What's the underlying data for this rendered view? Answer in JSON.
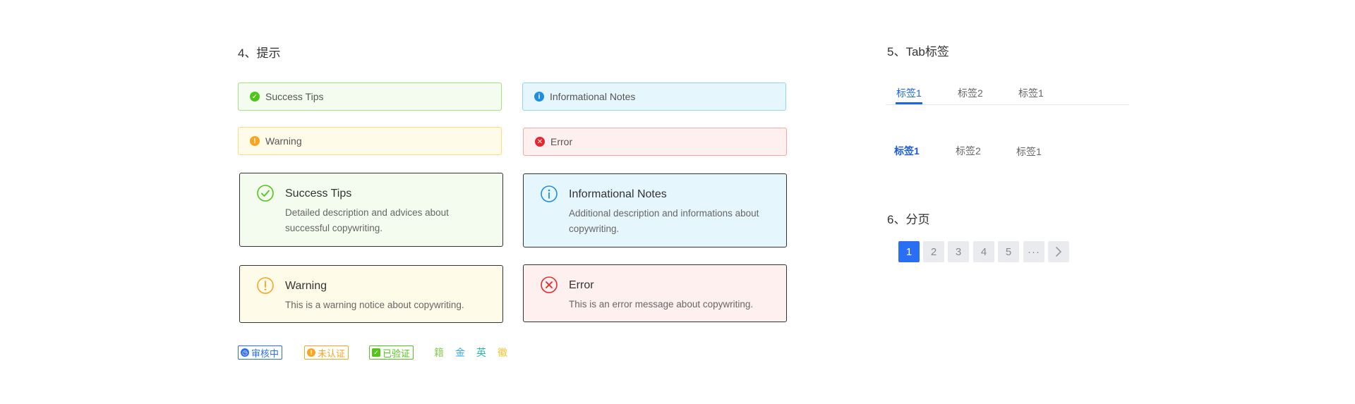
{
  "colors": {
    "success": "#52c41a",
    "info": "#1f8de0",
    "warning": "#f5a623",
    "error": "#e8262d",
    "primary": "#2a6ff3"
  },
  "section_alerts": {
    "title": "4、提示"
  },
  "alerts_small": [
    {
      "type": "success",
      "icon": "check-circle-icon",
      "text": "Success Tips"
    },
    {
      "type": "info",
      "icon": "info-circle-icon",
      "text": "Informational Notes"
    },
    {
      "type": "warning",
      "icon": "exclamation-circle-icon",
      "text": "Warning"
    },
    {
      "type": "error",
      "icon": "close-circle-icon",
      "text": "Error"
    }
  ],
  "alerts_large": [
    {
      "type": "success",
      "icon": "check-circle-outline-icon",
      "title": "Success Tips",
      "description": "Detailed description and advices about successful copywriting."
    },
    {
      "type": "info",
      "icon": "info-circle-outline-icon",
      "title": "Informational Notes",
      "description": "Additional description and informations about copywriting."
    },
    {
      "type": "warning",
      "icon": "exclamation-circle-outline-icon",
      "title": "Warning",
      "description": "This is a warning notice about copywriting."
    },
    {
      "type": "error",
      "icon": "close-circle-outline-icon",
      "title": "Error",
      "description": "This is an error message about copywriting."
    }
  ],
  "status_tags": [
    {
      "label": "审核中",
      "icon": "clock-icon",
      "color": "#2a6ff3"
    },
    {
      "label": "未认证",
      "icon": "exclamation-circle-icon",
      "color": "#f5a623"
    },
    {
      "label": "已验证",
      "icon": "shield-check-icon",
      "color": "#52c41a"
    }
  ],
  "char_tags": [
    {
      "label": "籍",
      "color": "#8ccf5a"
    },
    {
      "label": "金",
      "color": "#3aa8e8"
    },
    {
      "label": "英",
      "color": "#2fb5a8"
    },
    {
      "label": "徽",
      "color": "#f2c230"
    }
  ],
  "section_tabs": {
    "title": "5、Tab标签"
  },
  "tabs_underline": {
    "items": [
      "标签1",
      "标签2",
      "标签1"
    ],
    "active_index": 0
  },
  "tabs_bold": {
    "items": [
      "标签1",
      "标签2",
      "标签1"
    ],
    "active_index": 0
  },
  "section_pagination": {
    "title": "6、分页"
  },
  "pagination": {
    "pages": [
      "1",
      "2",
      "3",
      "4",
      "5"
    ],
    "current": "1",
    "ellipsis": "···",
    "next_icon": "chevron-right-icon"
  }
}
